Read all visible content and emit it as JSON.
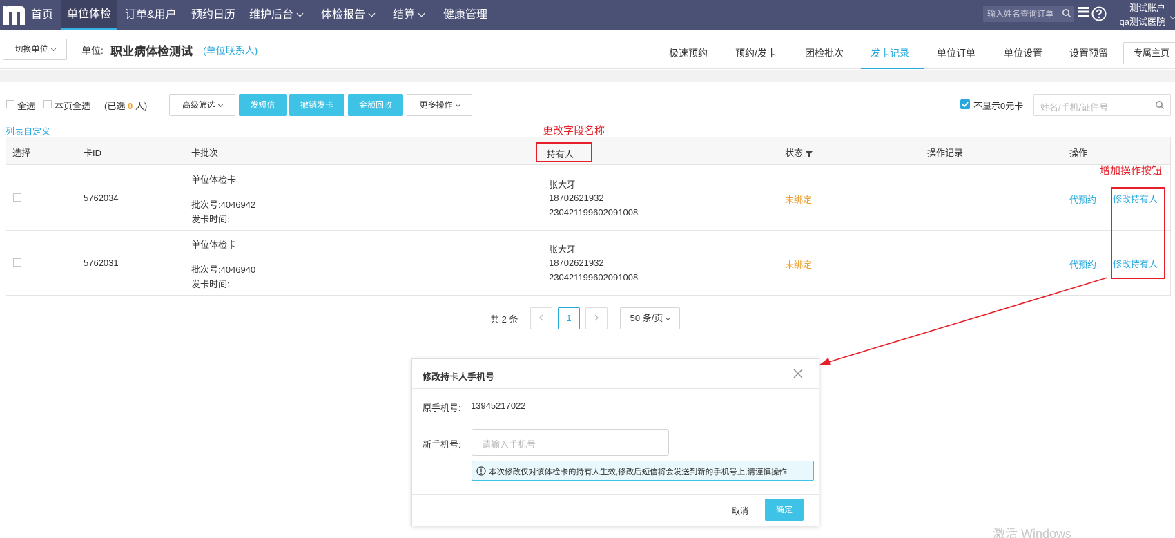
{
  "nav": {
    "items": [
      "首页",
      "单位体检",
      "订单&用户",
      "预约日历",
      "维护后台",
      "体检报告",
      "结算",
      "健康管理"
    ],
    "search_placeholder": "输入姓名查询订单",
    "account": "测试账户",
    "hospital": "qa测试医院"
  },
  "subbar": {
    "switch_unit": "切换单位",
    "unit_label": "单位:",
    "unit_name": "职业病体检测试",
    "unit_contact": "(单位联系人)",
    "tabs": [
      "极速预约",
      "预约/发卡",
      "团检批次",
      "发卡记录",
      "单位订单",
      "单位设置",
      "设置预留",
      "专属主页"
    ]
  },
  "toolbar": {
    "select_all": "全选",
    "page_select_all": "本页全选",
    "selected_prefix": "(已选",
    "selected_count": "0",
    "selected_suffix": "人)",
    "advanced_filter": "高级筛选",
    "send_sms": "发短信",
    "revoke_card": "撤销发卡",
    "refund_amount": "金额回收",
    "more_actions": "更多操作",
    "hide_zero_card": "不显示0元卡",
    "search_placeholder": "姓名/手机/证件号"
  },
  "list_custom": "列表自定义",
  "annotations": {
    "rename_field": "更改字段名称",
    "add_action": "增加操作按钮"
  },
  "table": {
    "headers": [
      "选择",
      "卡ID",
      "卡批次",
      "持有人",
      "状态",
      "操作记录",
      "操作"
    ],
    "rows": [
      {
        "card_id": "5762034",
        "batch_title": "单位体检卡",
        "batch_no": "批次号:4046942",
        "issue_time": "发卡时间:",
        "holder_name": "张大牙",
        "holder_phone": "18702621932",
        "holder_id": "230421199602091008",
        "status": "未绑定",
        "action_book": "代预约",
        "action_edit": "修改持有人"
      },
      {
        "card_id": "5762031",
        "batch_title": "单位体检卡",
        "batch_no": "批次号:4046940",
        "issue_time": "发卡时间:",
        "holder_name": "张大牙",
        "holder_phone": "18702621932",
        "holder_id": "230421199602091008",
        "status": "未绑定",
        "action_book": "代预约",
        "action_edit": "修改持有人"
      }
    ]
  },
  "pagination": {
    "total": "共 2 条",
    "current_page": "1",
    "page_size": "50 条/页"
  },
  "modal": {
    "title": "修改持卡人手机号",
    "original_label": "原手机号:",
    "original_value": "13945217022",
    "new_label": "新手机号:",
    "new_placeholder": "请输入手机号",
    "notice": "本次修改仅对该体检卡的持有人生效,修改后短信将会发送到新的手机号上,请谨慎操作",
    "cancel": "取消",
    "confirm": "确定"
  },
  "watermark": "激活 Windows",
  "colors": {
    "nav_bg": "#4b5075",
    "accent": "#28a9de",
    "button_blue": "#3ec2e6",
    "status_orange": "#f0a030",
    "annotation_red": "#e5202a"
  }
}
